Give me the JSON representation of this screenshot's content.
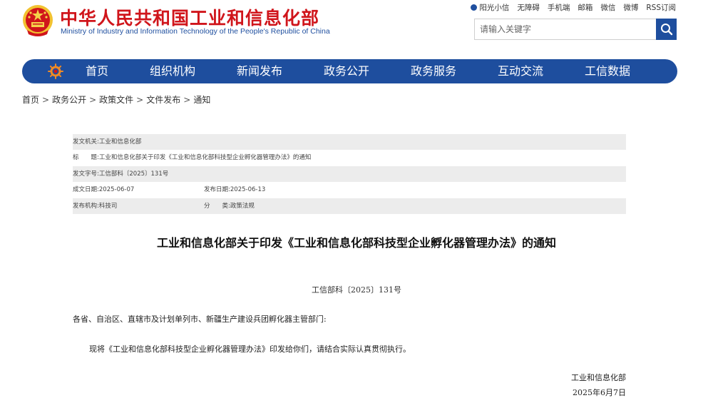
{
  "header": {
    "title": "中华人民共和国工业和信息化部",
    "subtitle": "Ministry of Industry and Information Technology of the People's Republic of China",
    "accent_color": "#d0151b",
    "brand_blue": "#1e4e9e"
  },
  "toplinks": [
    "阳光小信",
    "无障碍",
    "手机端",
    "邮箱",
    "微信",
    "微博",
    "RSS订阅"
  ],
  "search": {
    "placeholder": "请输入关键字",
    "icon": "search-icon"
  },
  "nav": [
    "首页",
    "组织机构",
    "新闻发布",
    "政务公开",
    "政务服务",
    "互动交流",
    "工信数据"
  ],
  "breadcrumb": [
    "首页",
    "政务公开",
    "政策文件",
    "文件发布",
    "通知"
  ],
  "meta": {
    "issuer_label": "发文机关:",
    "issuer": "工业和信息化部",
    "title_label": "标　　题:",
    "title": "工业和信息化部关于印发《工业和信息化部科技型企业孵化器管理办法》的通知",
    "doc_no_label": "发文字号:",
    "doc_no": "工信部科〔2025〕131号",
    "created_label": "成文日期:",
    "created": "2025-06-07",
    "published_label": "发布日期:",
    "published": "2025-06-13",
    "agency_label": "发布机构:",
    "agency": "科技司",
    "category_label": "分　　类:",
    "category": "政策法规"
  },
  "article": {
    "title": "工业和信息化部关于印发《工业和信息化部科技型企业孵化器管理办法》的通知",
    "doc_number": "工信部科〔2025〕131号",
    "addressee": "各省、自治区、直辖市及计划单列市、新疆生产建设兵团孵化器主管部门:",
    "body": "现将《工业和信息化部科技型企业孵化器管理办法》印发给你们，请结合实际认真贯彻执行。",
    "sign_org": "工业和信息化部",
    "sign_date": "2025年6月7日"
  }
}
